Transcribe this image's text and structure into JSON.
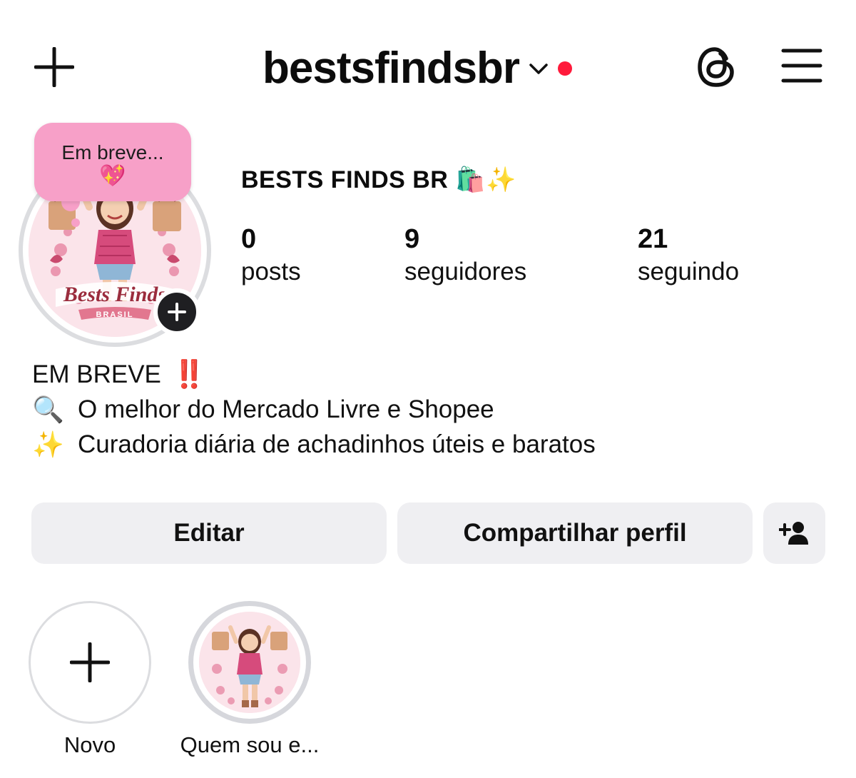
{
  "header": {
    "username": "bestsfindsbr",
    "icons": {
      "add": "plus-icon",
      "account_switch": "chevron-down-icon",
      "threads": "threads-icon",
      "menu": "hamburger-menu-icon"
    },
    "notification_dot_color": "#ff1a3b"
  },
  "note": {
    "text": "Em breve...",
    "emoji": "💖",
    "color": "#f7a0c8"
  },
  "avatar": {
    "brand_text": "Bests Finds",
    "brand_subtext": "BRASIL",
    "add_icon": "plus-circle-icon"
  },
  "profile": {
    "display_name": "BESTS FINDS BR 🛍️✨",
    "stats": [
      {
        "value": "0",
        "label": "posts"
      },
      {
        "value": "9",
        "label": "seguidores"
      },
      {
        "value": "21",
        "label": "seguindo"
      }
    ]
  },
  "bio": {
    "line1": "EM BREVE",
    "line1_mark": "‼️",
    "line2_emoji": "🔍",
    "line2": "O melhor do Mercado Livre e Shopee",
    "line3_emoji": "✨",
    "line3": "Curadoria diária de achadinhos úteis e baratos"
  },
  "actions": {
    "edit_label": "Editar",
    "share_label": "Compartilhar perfil",
    "add_user_icon": "person-add-icon"
  },
  "highlights": [
    {
      "label": "Novo",
      "icon": "plus-icon"
    },
    {
      "label": "Quem sou e..."
    }
  ]
}
